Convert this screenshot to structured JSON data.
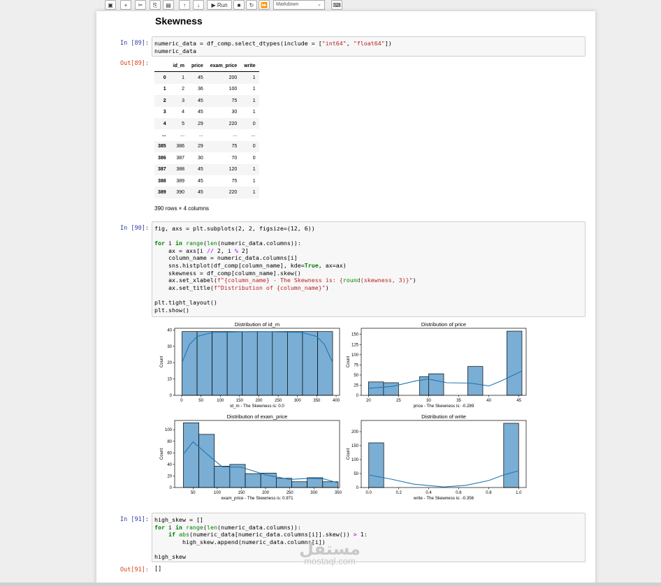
{
  "toolbar": {
    "run_label": "Run",
    "cell_type": "Markdown"
  },
  "heading": "Skewness",
  "cells": {
    "c89": {
      "in_prompt": "In [89]:",
      "out_prompt": "Out[89]:",
      "code_lines": [
        "numeric_data = df_comp.select_dtypes(include = [\"int64\", \"float64\"])",
        "numeric_data"
      ]
    },
    "c90": {
      "in_prompt": "In [90]:",
      "code_lines": [
        "fig, axs = plt.subplots(2, 2, figsize=(12, 6))",
        "",
        "for i in range(len(numeric_data.columns)):",
        "    ax = axs[i // 2, i % 2]",
        "    column_name = numeric_data.columns[i]",
        "    sns.histplot(df_comp[column_name], kde=True, ax=ax)",
        "    skewness = df_comp[column_name].skew()",
        "    ax.set_xlabel(f\"{column_name} - The Skewness is: {round(skewness, 3)}\")",
        "    ax.set_title(f\"Distribution of {column_name}\")",
        "",
        "plt.tight_layout()",
        "plt.show()"
      ]
    },
    "c91": {
      "in_prompt": "In [91]:",
      "out_prompt": "Out[91]:",
      "output": "[]",
      "code_lines": [
        "high_skew = []",
        "for i in range(len(numeric_data.columns)):",
        "    if abs(numeric_data[numeric_data.columns[i]].skew()) > 1:",
        "        high_skew.append(numeric_data.columns[i])",
        "",
        "high_skew"
      ]
    }
  },
  "dataframe": {
    "columns": [
      "id_m",
      "price",
      "exam_price",
      "write"
    ],
    "rows": [
      [
        "0",
        "1",
        "45",
        "200",
        "1"
      ],
      [
        "1",
        "2",
        "36",
        "100",
        "1"
      ],
      [
        "2",
        "3",
        "45",
        "75",
        "1"
      ],
      [
        "3",
        "4",
        "45",
        "30",
        "1"
      ],
      [
        "4",
        "5",
        "29",
        "220",
        "0"
      ],
      [
        "...",
        "...",
        "...",
        "...",
        "..."
      ],
      [
        "385",
        "386",
        "29",
        "75",
        "0"
      ],
      [
        "386",
        "387",
        "30",
        "70",
        "0"
      ],
      [
        "387",
        "388",
        "45",
        "120",
        "1"
      ],
      [
        "388",
        "389",
        "45",
        "75",
        "1"
      ],
      [
        "389",
        "390",
        "45",
        "220",
        "1"
      ]
    ],
    "shape_note": "390 rows × 4 columns"
  },
  "chart_data": [
    {
      "type": "bar",
      "title": "Distribution of id_m",
      "xlabel": "id_m - The Skewness is: 0.0",
      "ylabel": "Count",
      "xlim": [
        -18,
        409
      ],
      "ylim": [
        0,
        41
      ],
      "xticks": [
        0,
        50,
        100,
        150,
        200,
        250,
        300,
        350,
        400
      ],
      "yticks": [
        0,
        10,
        20,
        30,
        40
      ],
      "bins": [
        [
          1,
          40,
          39
        ],
        [
          40,
          79,
          39
        ],
        [
          79,
          118,
          39
        ],
        [
          118,
          157,
          39
        ],
        [
          157,
          196,
          39
        ],
        [
          196,
          235,
          39
        ],
        [
          235,
          274,
          39
        ],
        [
          274,
          313,
          39
        ],
        [
          313,
          352,
          39
        ],
        [
          352,
          391,
          39
        ]
      ],
      "kde": [
        [
          1,
          20
        ],
        [
          20,
          31
        ],
        [
          40,
          36
        ],
        [
          80,
          38.5
        ],
        [
          195,
          39
        ],
        [
          310,
          38.5
        ],
        [
          350,
          36
        ],
        [
          370,
          31
        ],
        [
          391,
          20
        ]
      ],
      "bar_color": "#7aaed4",
      "line_color": "#1f77b4"
    },
    {
      "type": "bar",
      "title": "Distribution of price",
      "xlabel": "price - The Skewness is: -0.289",
      "ylabel": "Count",
      "xlim": [
        18.8,
        46.2
      ],
      "ylim": [
        0,
        165
      ],
      "xticks": [
        20,
        25,
        30,
        35,
        40,
        45
      ],
      "yticks": [
        0,
        25,
        50,
        75,
        100,
        125,
        150
      ],
      "bins": [
        [
          20,
          22.5,
          33
        ],
        [
          22.5,
          25,
          31
        ],
        [
          28.5,
          31,
          46
        ],
        [
          30,
          32.5,
          53
        ],
        [
          36.5,
          39,
          71
        ],
        [
          43,
          45.5,
          158
        ]
      ],
      "kde": [
        [
          20,
          17
        ],
        [
          24,
          22
        ],
        [
          28,
          36
        ],
        [
          30,
          40
        ],
        [
          33,
          31
        ],
        [
          37,
          30
        ],
        [
          40,
          23
        ],
        [
          42,
          35
        ],
        [
          45.5,
          60
        ]
      ],
      "bar_color": "#7aaed4",
      "line_color": "#1f77b4"
    },
    {
      "type": "bar",
      "title": "Distribution of exam_price",
      "xlabel": "exam_price - The Skewness is: 0.971",
      "ylabel": "Count",
      "xlim": [
        12,
        353
      ],
      "ylim": [
        0,
        116
      ],
      "xticks": [
        50,
        100,
        150,
        200,
        250,
        300,
        350
      ],
      "yticks": [
        0,
        20,
        40,
        60,
        80,
        100
      ],
      "bins": [
        [
          30,
          62,
          112
        ],
        [
          62,
          94,
          92
        ],
        [
          94,
          126,
          37
        ],
        [
          126,
          158,
          40
        ],
        [
          158,
          190,
          24
        ],
        [
          190,
          222,
          25
        ],
        [
          222,
          254,
          16
        ],
        [
          254,
          286,
          10
        ],
        [
          286,
          318,
          17
        ],
        [
          318,
          350,
          10
        ]
      ],
      "kde": [
        [
          30,
          58
        ],
        [
          50,
          79
        ],
        [
          80,
          57
        ],
        [
          110,
          36
        ],
        [
          150,
          35
        ],
        [
          200,
          22
        ],
        [
          250,
          14
        ],
        [
          290,
          16
        ],
        [
          320,
          15
        ],
        [
          350,
          8
        ]
      ],
      "bar_color": "#7aaed4",
      "line_color": "#1f77b4"
    },
    {
      "type": "bar",
      "title": "Distribution of write",
      "xlabel": "write - The Skewness is: -0.356",
      "ylabel": "Count",
      "xlim": [
        -0.05,
        1.05
      ],
      "ylim": [
        0,
        240
      ],
      "xticks": [
        0.0,
        0.2,
        0.4,
        0.6,
        0.8,
        1.0
      ],
      "xtick_labels": [
        "0.0",
        "0.2",
        "0.4",
        "0.6",
        "0.8",
        "1.0"
      ],
      "yticks": [
        0,
        50,
        100,
        150,
        200
      ],
      "bins": [
        [
          0,
          0.1,
          160
        ],
        [
          0.9,
          1.0,
          230
        ]
      ],
      "kde": [
        [
          0,
          45
        ],
        [
          0.15,
          30
        ],
        [
          0.3,
          12
        ],
        [
          0.5,
          2
        ],
        [
          0.65,
          8
        ],
        [
          0.8,
          25
        ],
        [
          0.9,
          45
        ],
        [
          1.0,
          60
        ]
      ],
      "bar_color": "#7aaed4",
      "line_color": "#1f77b4"
    }
  ],
  "watermark": {
    "logo": "مستقل",
    "url": "mostaql.com"
  }
}
